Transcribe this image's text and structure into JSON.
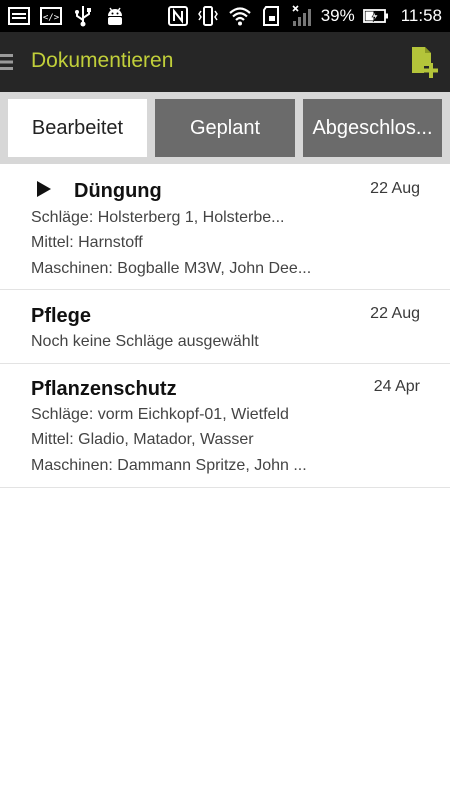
{
  "status_bar": {
    "battery_percent": "39%",
    "time": "11:58",
    "icons": [
      "image-icon",
      "code-icon",
      "usb-icon",
      "android-icon",
      "nfc-icon",
      "vibrate-icon",
      "wifi-icon",
      "sd-card-icon",
      "signal-icon",
      "battery-charging-icon"
    ]
  },
  "action_bar": {
    "title": "Dokumentieren",
    "menu_icon": "hamburger-menu-icon",
    "action_icon": "add-document-icon",
    "accent_color": "#c1cf3a"
  },
  "tabs": [
    {
      "label": "Bearbeitet",
      "selected": true
    },
    {
      "label": "Geplant",
      "selected": false
    },
    {
      "label": "Abgeschlos...",
      "selected": false
    }
  ],
  "items": [
    {
      "title": "Düngung",
      "date": "22 Aug",
      "lines": [
        "Schläge: Holsterberg 1, Holsterbe...",
        "Mittel: Harnstoff",
        "Maschinen: Bogballe M3W, John Dee..."
      ]
    },
    {
      "title": "Pflege",
      "date": "22 Aug",
      "lines": [
        "Noch keine Schläge ausgewählt"
      ]
    },
    {
      "title": "Pflanzenschutz",
      "date": "24 Apr",
      "lines": [
        "Schläge: vorm Eichkopf-01, Wietfeld",
        "Mittel: Gladio, Matador, Wasser",
        "Maschinen: Dammann Spritze, John ..."
      ]
    }
  ]
}
